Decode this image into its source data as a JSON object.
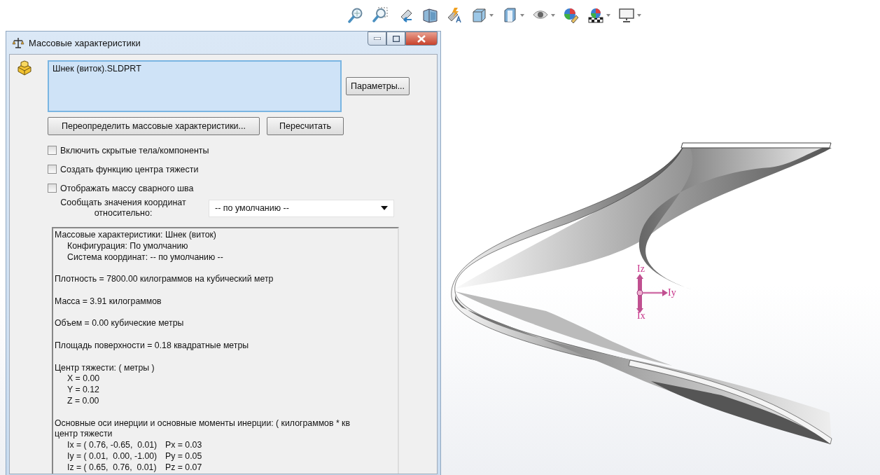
{
  "toolbar": {
    "tools": [
      {
        "kind": "zoom-fit",
        "dropdown": false
      },
      {
        "kind": "zoom-area",
        "dropdown": false
      },
      {
        "kind": "previous-view",
        "dropdown": false
      },
      {
        "kind": "section",
        "dropdown": false
      },
      {
        "kind": "annotation",
        "dropdown": false
      },
      {
        "kind": "orientation",
        "dropdown": true
      },
      {
        "kind": "display-style",
        "dropdown": true
      },
      {
        "kind": "hide-show",
        "dropdown": true
      },
      {
        "kind": "appearance",
        "dropdown": false
      },
      {
        "kind": "scene",
        "dropdown": true
      },
      {
        "kind": "monitor",
        "dropdown": true
      }
    ]
  },
  "dialog": {
    "title": "Массовые характеристики",
    "selection": {
      "items": [
        {
          "label": "Шнек (виток).SLDPRT",
          "selected": false
        }
      ]
    },
    "buttons": {
      "options": "Параметры...",
      "override": "Переопределить массовые характеристики...",
      "recalculate": "Пересчитать"
    },
    "checkboxes": [
      {
        "label": "Включить скрытые тела/компоненты",
        "checked": false
      },
      {
        "label": "Создать функцию центра тяжести",
        "checked": false
      },
      {
        "label": "Отображать массу сварного шва",
        "checked": false
      }
    ],
    "coordinate_label": "Сообщать значения координат относительно:",
    "coordinate_value": "-- по умолчанию --",
    "results": [
      [
        {
          "text": "Массовые характеристики: Шнек (виток)",
          "children": [
            {
              "text": "Конфигурация: По умолчанию"
            },
            {
              "text": "Система координат: -- по умолчанию --"
            }
          ]
        }
      ],
      [
        {
          "text": "Плотность = 7800.00 килограммов на кубический метр"
        }
      ],
      [
        {
          "text": "Масса = 3.91 килограммов"
        }
      ],
      [
        {
          "text": "Объем = 0.00 кубические метры"
        }
      ],
      [
        {
          "text": "Площадь поверхности = 0.18 квадратные метры"
        }
      ],
      [
        {
          "text": "Центр тяжести: ( метры )",
          "children": [
            {
              "text": "X = 0.00"
            },
            {
              "text": "Y = 0.12"
            },
            {
              "text": "Z = 0.00"
            }
          ]
        }
      ],
      [
        {
          "text": "Основные оси инерции и основные моменты инерции: ( килограммов * кв"
        },
        {
          "text": "центр тяжести",
          "children": [
            {
              "cells": [
                "Ix = ( 0.76, -0.65,  0.01)",
                "Px = 0.03"
              ]
            },
            {
              "cells": [
                "Iy = ( 0.01,  0.00, -1.00)",
                "Py = 0.05"
              ]
            },
            {
              "cells": [
                "Iz = ( 0.65,  0.76,  0.01)",
                "Pz = 0.07"
              ]
            }
          ]
        }
      ]
    ]
  },
  "viewport": {
    "triad": {
      "z": "Iz",
      "y": "Iy",
      "x": "Ix"
    }
  }
}
